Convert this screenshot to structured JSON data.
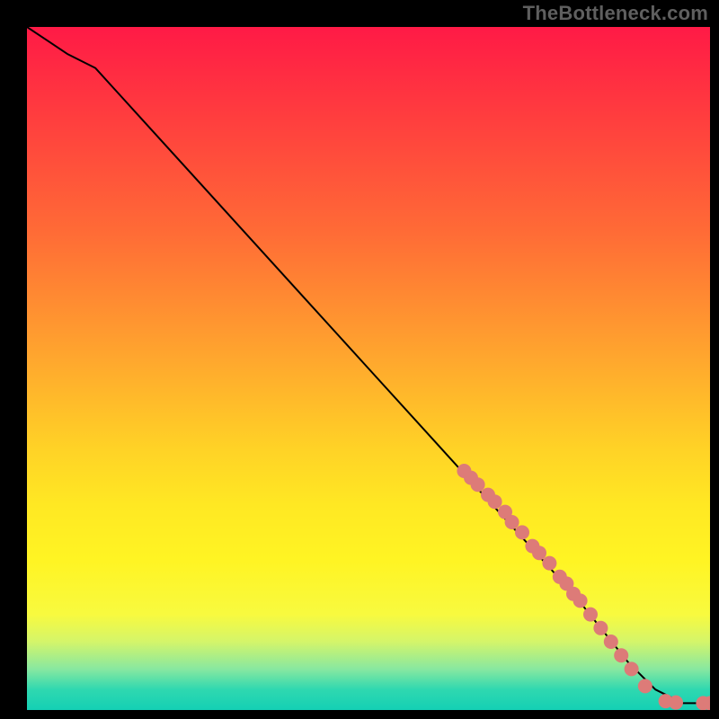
{
  "watermark": "TheBottleneck.com",
  "chart_data": {
    "type": "line",
    "title": "",
    "xlabel": "",
    "ylabel": "",
    "xlim": [
      0,
      100
    ],
    "ylim": [
      0,
      100
    ],
    "grid": false,
    "series": [
      {
        "name": "curve",
        "color": "#000000",
        "x": [
          0,
          3,
          6,
          10,
          20,
          30,
          40,
          50,
          60,
          70,
          80,
          88,
          92,
          96,
          100
        ],
        "y": [
          100,
          98,
          96,
          94,
          83,
          72,
          61,
          50,
          39,
          28,
          17,
          7,
          3,
          1,
          1
        ]
      }
    ],
    "markers": {
      "name": "cluster",
      "color": "#dd7b78",
      "radius": 8,
      "points": [
        {
          "x": 64,
          "y": 35
        },
        {
          "x": 65,
          "y": 34
        },
        {
          "x": 66,
          "y": 33
        },
        {
          "x": 67.5,
          "y": 31.5
        },
        {
          "x": 68.5,
          "y": 30.5
        },
        {
          "x": 70,
          "y": 29
        },
        {
          "x": 71,
          "y": 27.5
        },
        {
          "x": 72.5,
          "y": 26
        },
        {
          "x": 74,
          "y": 24
        },
        {
          "x": 75,
          "y": 23
        },
        {
          "x": 76.5,
          "y": 21.5
        },
        {
          "x": 78,
          "y": 19.5
        },
        {
          "x": 79,
          "y": 18.5
        },
        {
          "x": 80,
          "y": 17
        },
        {
          "x": 81,
          "y": 16
        },
        {
          "x": 82.5,
          "y": 14
        },
        {
          "x": 84,
          "y": 12
        },
        {
          "x": 85.5,
          "y": 10
        },
        {
          "x": 87,
          "y": 8
        },
        {
          "x": 88.5,
          "y": 6
        },
        {
          "x": 90.5,
          "y": 3.5
        },
        {
          "x": 93.5,
          "y": 1.3
        },
        {
          "x": 95,
          "y": 1.1
        },
        {
          "x": 99,
          "y": 1.0
        },
        {
          "x": 100,
          "y": 1.0
        }
      ]
    }
  }
}
